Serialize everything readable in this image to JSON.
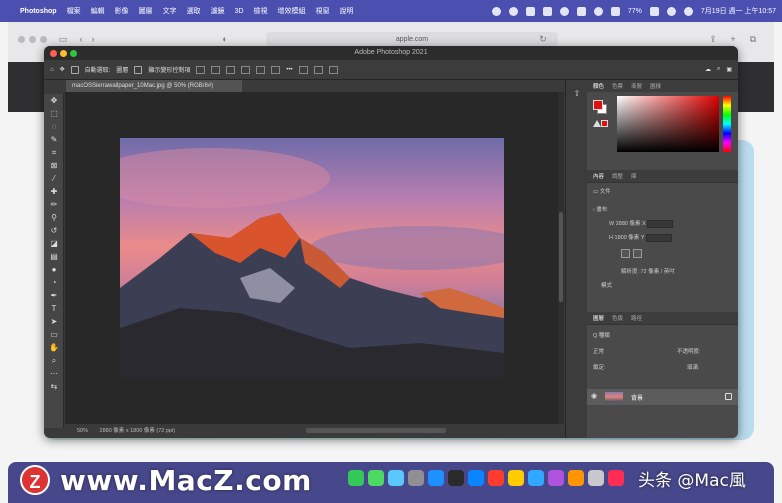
{
  "menubar": {
    "app_name": "Photoshop",
    "items": [
      "檔案",
      "編輯",
      "影像",
      "圖層",
      "文字",
      "選取",
      "濾鏡",
      "3D",
      "檢視",
      "增效模組",
      "視窗",
      "說明"
    ],
    "battery": "77%",
    "datetime": "7月19日 週一 上午10:57"
  },
  "safari": {
    "url": "apple.com"
  },
  "photoshop": {
    "window_title": "Adobe Photoshop 2021",
    "options_bar": {
      "auto_select_label": "自動選取:",
      "auto_select_value": "圖層",
      "show_transform_label": "顯示變形控制項"
    },
    "document_tab": "macOSSierrawallpaper_10Mac.jpg @ 50% (RGB/8#)",
    "status": {
      "zoom": "50%",
      "doc_info": "2880 像素 x 1800 像素 (72 ppi)"
    },
    "color_panel": {
      "tabs": [
        "顏色",
        "色票",
        "漸層",
        "圖樣"
      ]
    },
    "properties_panel": {
      "tabs": [
        "內容",
        "調整",
        "庫"
      ],
      "doc_label": "文件",
      "section_label": "畫布",
      "width_label": "W",
      "width_value": "2880 像素",
      "x_label": "X",
      "height_label": "H",
      "height_value": "1800 像素",
      "y_label": "Y",
      "resolution": "解析度: 72 像素 / 英吋",
      "mode_label": "模式"
    },
    "layers_panel": {
      "tabs": [
        "圖層",
        "色版",
        "路徑"
      ],
      "search_placeholder": "Q 種類",
      "blend_mode": "正常",
      "opacity_label": "不透明度:",
      "lock_label": "鎖定:",
      "fill_label": "填滿:",
      "layer_name": "背景"
    }
  },
  "watermark": {
    "logo_letter": "Z",
    "site": "www.MacZ.com",
    "credit": "头条 @Mac風"
  },
  "colors": {
    "menubar": "#4a4fb0",
    "foreground_color": "#e01010",
    "ps_panel": "#4a4a4a"
  }
}
